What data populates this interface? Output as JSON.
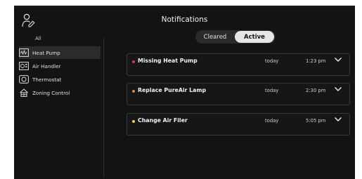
{
  "header": {
    "title": "Notifications"
  },
  "sidebar": {
    "all_label": "All",
    "items": [
      {
        "label": "Heat Pump",
        "icon": "heat-pump-icon",
        "selected": true
      },
      {
        "label": "Air Handler",
        "icon": "air-handler-icon",
        "selected": false
      },
      {
        "label": "Thermostat",
        "icon": "thermostat-icon",
        "selected": false
      },
      {
        "label": "Zoning Control",
        "icon": "zoning-control-icon",
        "selected": false
      }
    ]
  },
  "filter_toggle": {
    "cleared_label": "Cleared",
    "active_label": "Active",
    "selected": "Active"
  },
  "notifications": [
    {
      "title": "Missing Heat Pump",
      "day": "today",
      "time": "1:23 pm",
      "dot_color": "#e5334d"
    },
    {
      "title": "Replace PureAir Lamp",
      "day": "today",
      "time": "2:30 pm",
      "dot_color": "#f07a2f"
    },
    {
      "title": "Change Air Filer",
      "day": "today",
      "time": "5:05 pm",
      "dot_color": "#f2d22e"
    }
  ],
  "colors": {
    "background": "#131313",
    "panel_border": "#3a3a3a",
    "selected_item": "#2b2b2b"
  }
}
